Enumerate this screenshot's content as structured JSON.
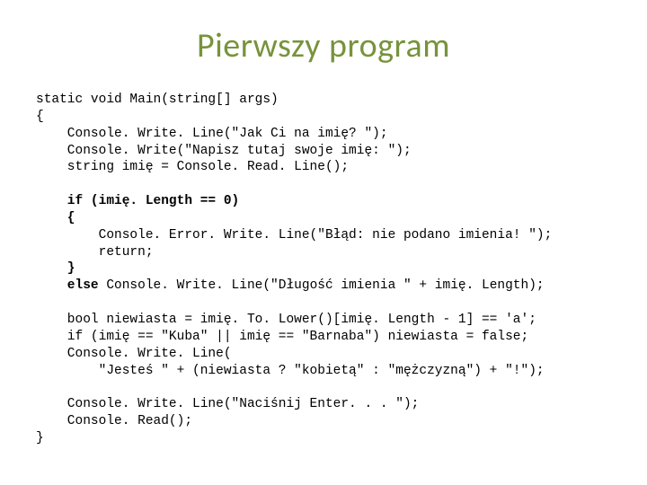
{
  "title": "Pierwszy program",
  "code": {
    "l1": "static void Main(string[] args)",
    "l2": "{",
    "l3": "    Console. Write. Line(\"Jak Ci na imię? \");",
    "l4": "    Console. Write(\"Napisz tutaj swoje imię: \");",
    "l5": "    string imię = Console. Read. Line();",
    "l6": "",
    "l7a": "    if (imię. Length == 0)",
    "l7b": "    {",
    "l8": "        Console. Error. Write. Line(\"Błąd: nie podano imienia! \");",
    "l9": "        return;",
    "l10a": "    }",
    "l10b": "    else",
    "l10c": " Console. Write. Line(\"Długość imienia \" + imię. Length);",
    "l11": "",
    "l12": "    bool niewiasta = imię. To. Lower()[imię. Length - 1] == 'a';",
    "l13": "    if (imię == \"Kuba\" || imię == \"Barnaba\") niewiasta = false;",
    "l14": "    Console. Write. Line(",
    "l15": "        \"Jesteś \" + (niewiasta ? \"kobietą\" : \"mężczyzną\") + \"!\");",
    "l16": "",
    "l17": "    Console. Write. Line(\"Naciśnij Enter. . . \");",
    "l18": "    Console. Read();",
    "l19": "}"
  }
}
